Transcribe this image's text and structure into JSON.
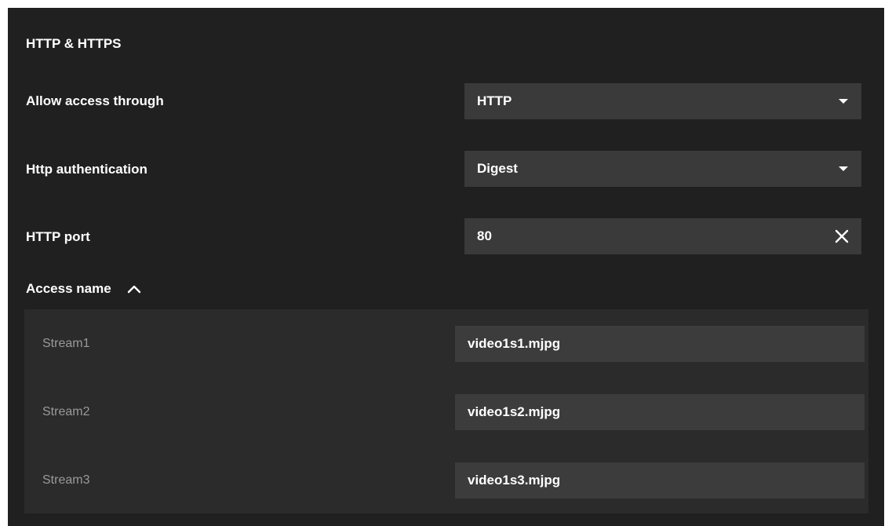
{
  "section": {
    "title": "HTTP & HTTPS"
  },
  "settings": {
    "allow_access": {
      "label": "Allow access through",
      "value": "HTTP",
      "icon": "caret-down-icon"
    },
    "http_auth": {
      "label": "Http authentication",
      "value": "Digest",
      "icon": "caret-down-icon"
    },
    "http_port": {
      "label": "HTTP port",
      "value": "80",
      "icon": "clear-icon"
    }
  },
  "access_name": {
    "label": "Access name",
    "expanded": true,
    "icon": "chevron-up-icon",
    "streams": [
      {
        "label": "Stream1",
        "value": "video1s1.mjpg"
      },
      {
        "label": "Stream2",
        "value": "video1s2.mjpg"
      },
      {
        "label": "Stream3",
        "value": "video1s3.mjpg"
      }
    ]
  },
  "colors": {
    "panel_bg": "#202020",
    "control_bg": "#3a3a3a",
    "subpanel_bg": "#2b2b2b",
    "text": "#ffffff",
    "muted_text": "#9a9a9a"
  }
}
